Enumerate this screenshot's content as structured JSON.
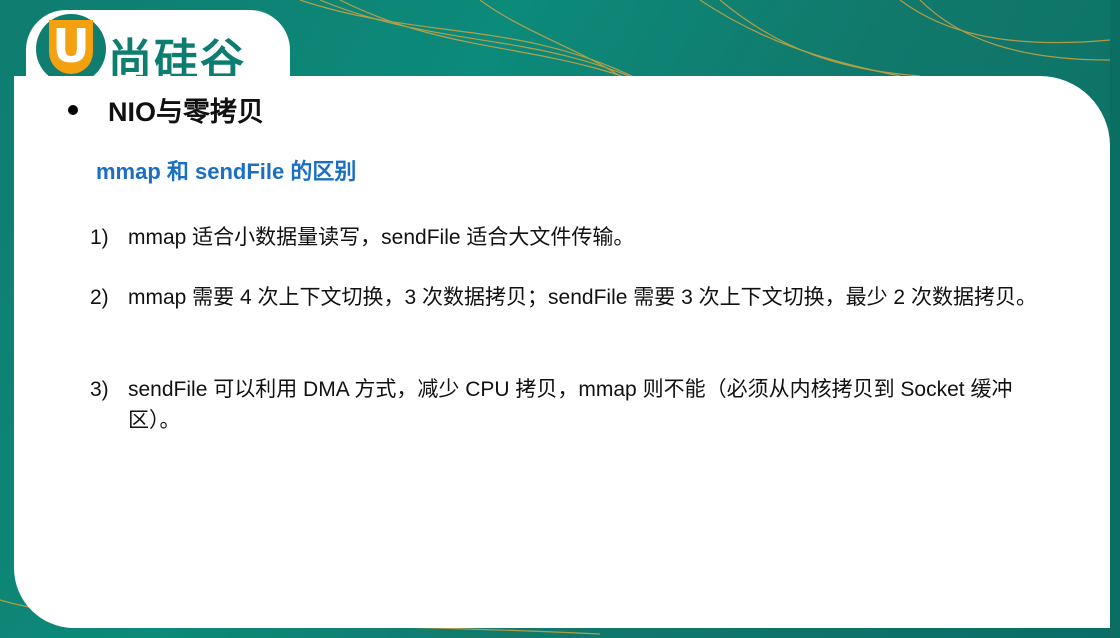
{
  "logo": {
    "mark": "U",
    "brand": "尚硅谷"
  },
  "heading": "NIO与零拷贝",
  "subheading": "mmap 和 sendFile 的区别",
  "items": [
    {
      "num": "1)",
      "text": "mmap 适合小数据量读写，sendFile  适合大文件传输。"
    },
    {
      "num": "2)",
      "text": "mmap 需要 4 次上下文切换，3 次数据拷贝；sendFile  需要 3 次上下文切换，最少 2 次数据拷贝。"
    },
    {
      "num": "3)",
      "text": "sendFile 可以利用 DMA 方式，减少 CPU 拷贝，mmap 则不能（必须从内核拷贝到 Socket 缓冲区）。"
    }
  ],
  "colors": {
    "teal": "#0f7d6f",
    "orange": "#f5a00f",
    "subheading": "#1a6fc4"
  }
}
